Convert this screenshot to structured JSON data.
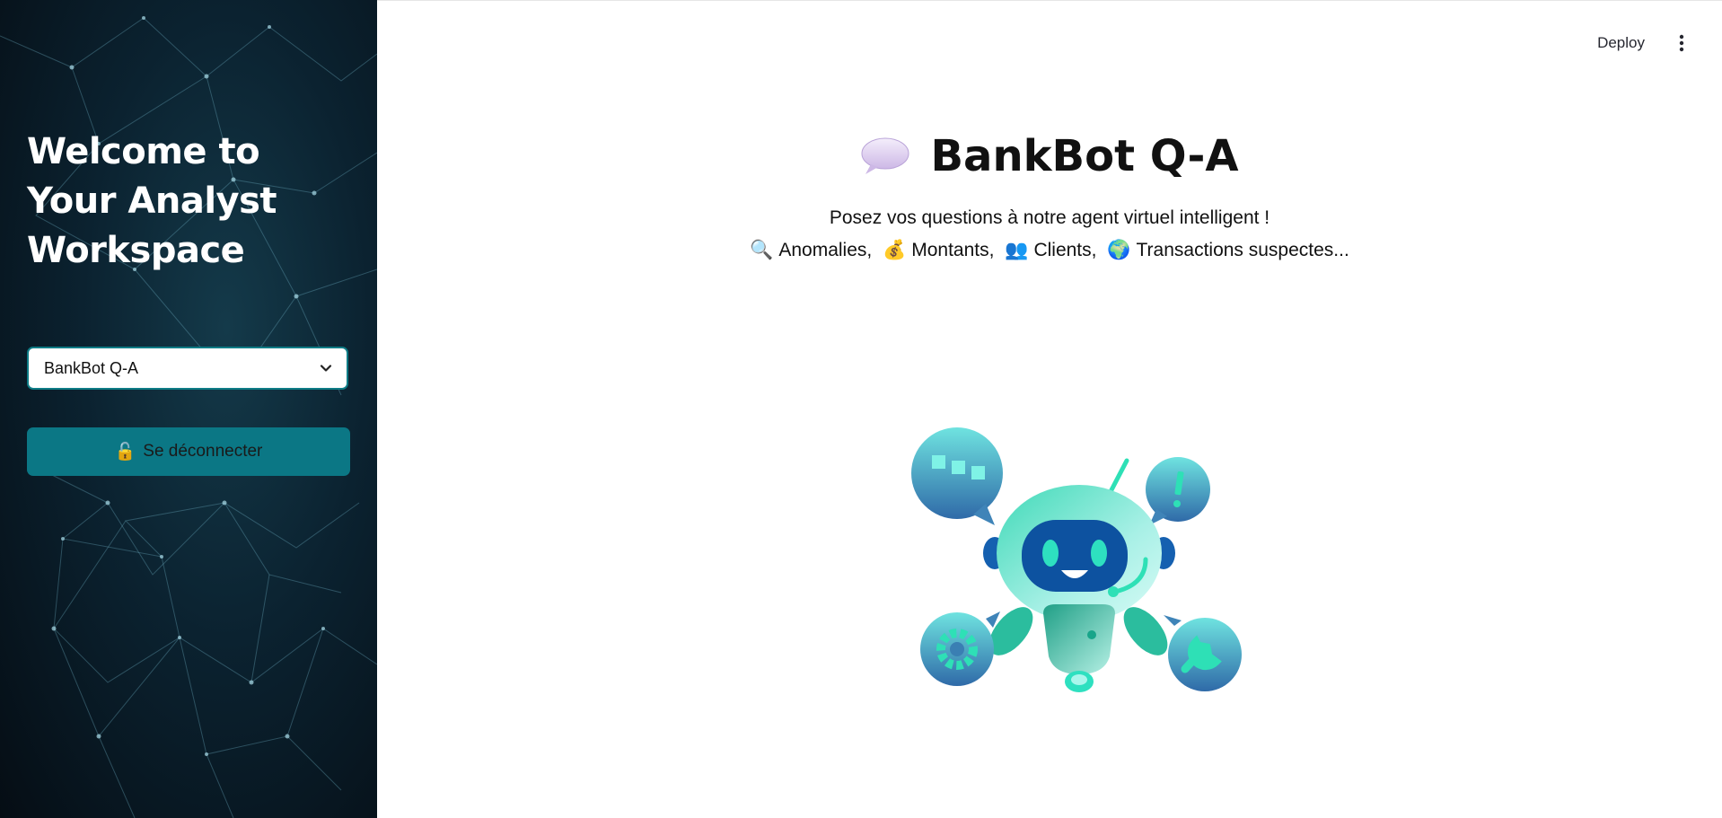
{
  "sidebar": {
    "title": "Welcome to Your Analyst Workspace",
    "select": {
      "value": "BankBot Q-A",
      "icon": "chevron-down-icon"
    },
    "logout": {
      "icon": "🔓",
      "label": "Se déconnecter"
    }
  },
  "header": {
    "deploy_label": "Deploy",
    "menu_icon": "vertical-dots-icon"
  },
  "main": {
    "title_icon": "speech-bubble-icon",
    "title": "BankBot Q-A",
    "subtitle": "Posez vos questions à notre agent virtuel intelligent !",
    "topics": [
      {
        "emoji": "🔍",
        "label": "Anomalies,"
      },
      {
        "emoji": "💰",
        "label": "Montants,"
      },
      {
        "emoji": "👥",
        "label": "Clients,"
      },
      {
        "emoji": "🌍",
        "label": "Transactions suspectes..."
      }
    ],
    "illustration": "chatbot-robot-illustration"
  },
  "colors": {
    "sidebar_bg": "#0b2230",
    "accent": "#0b7785",
    "robot_teal": "#2fd3b5",
    "robot_blue": "#0d4f9a"
  }
}
